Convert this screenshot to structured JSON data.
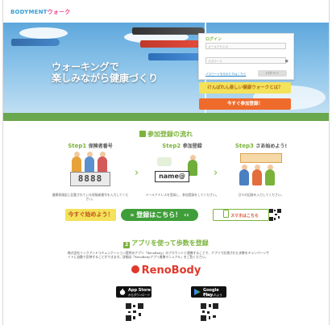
{
  "header": {
    "logo_part1": "BODYMENT",
    "logo_part2": "ウォーク"
  },
  "hero": {
    "catch_line1": "ウォーキングで",
    "catch_line2": "楽しみながら健康づくり",
    "login": {
      "title": "ログイン",
      "email_placeholder": "メールアドレス",
      "password_placeholder": "パスワード",
      "forgot_link": "パスワードを忘れた方はこちら",
      "login_button": "ログイン"
    },
    "about_button": "けんぽれん楽しい健康ウォークとは？",
    "join_button": "今すぐ参加登録！"
  },
  "flow": {
    "title": "参加登録の流れ",
    "steps": [
      {
        "label": "Step1",
        "title": "保険者番号",
        "desc": "健康保険証に記載されている保険者番号を入力してください。",
        "display": "8888"
      },
      {
        "label": "Step2",
        "title": "参加登録",
        "desc": "メールアドレスを登録し、参加登録をしてください。",
        "display": "name@"
      },
      {
        "label": "Step3",
        "title": "さあ始めよう!",
        "desc": "日々の記録を入力してください。",
        "display": ""
      }
    ],
    "arrow_glyph": "›"
  },
  "cta": {
    "start_button": "今すぐ始めよう！",
    "register_button": "登録はこちら！",
    "register_prefix": "»",
    "register_suffix": "‹‹",
    "smartphone_button": "スマホはこちら"
  },
  "app": {
    "title": "アプリを使って歩数を登録",
    "number_badge": "2",
    "description": "株式会社リンクアンドコミュニケーション提供のアプリ「RenoBody」のアカウントと連携することで、アプリで計測された歩数をキャンペーンサイトに自動で反映することができます。詳細は「RenoBodyアプリ連携マニュアル」をご覧ください。",
    "brand": "RenoBody",
    "app_store_line1": "App Store",
    "app_store_line2": "からダウンロード",
    "google_play_line1": "Google Play",
    "google_play_line2": "で手に入れよう"
  },
  "colors": {
    "accent_green": "#7bb33a",
    "orange": "#ef6b2b",
    "reno_red": "#e0392b",
    "yellow": "#f3e25a"
  }
}
